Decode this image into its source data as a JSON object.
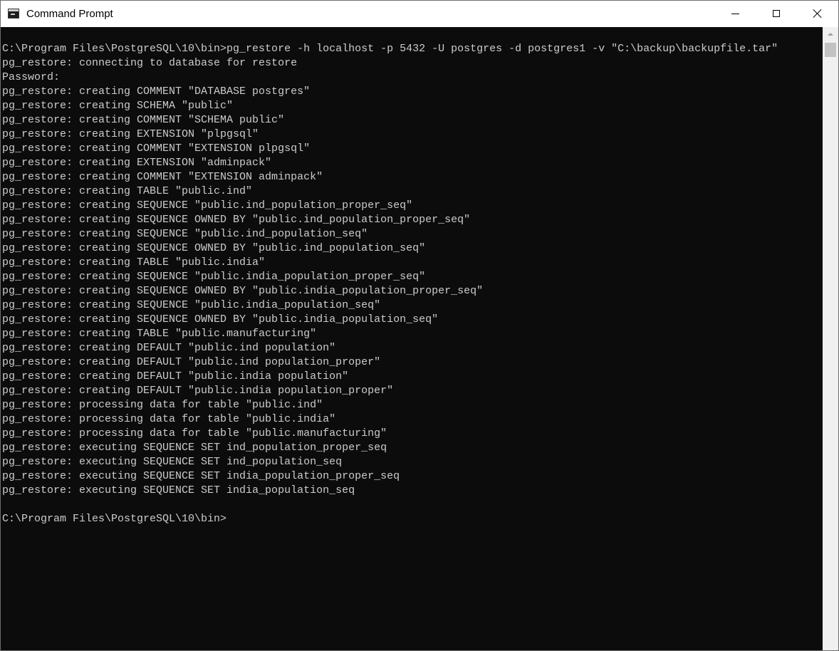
{
  "window": {
    "title": "Command Prompt"
  },
  "console": {
    "lines": [
      "C:\\Program Files\\PostgreSQL\\10\\bin>pg_restore -h localhost -p 5432 -U postgres -d postgres1 -v \"C:\\backup\\backupfile.tar\"",
      "pg_restore: connecting to database for restore",
      "Password:",
      "pg_restore: creating COMMENT \"DATABASE postgres\"",
      "pg_restore: creating SCHEMA \"public\"",
      "pg_restore: creating COMMENT \"SCHEMA public\"",
      "pg_restore: creating EXTENSION \"plpgsql\"",
      "pg_restore: creating COMMENT \"EXTENSION plpgsql\"",
      "pg_restore: creating EXTENSION \"adminpack\"",
      "pg_restore: creating COMMENT \"EXTENSION adminpack\"",
      "pg_restore: creating TABLE \"public.ind\"",
      "pg_restore: creating SEQUENCE \"public.ind_population_proper_seq\"",
      "pg_restore: creating SEQUENCE OWNED BY \"public.ind_population_proper_seq\"",
      "pg_restore: creating SEQUENCE \"public.ind_population_seq\"",
      "pg_restore: creating SEQUENCE OWNED BY \"public.ind_population_seq\"",
      "pg_restore: creating TABLE \"public.india\"",
      "pg_restore: creating SEQUENCE \"public.india_population_proper_seq\"",
      "pg_restore: creating SEQUENCE OWNED BY \"public.india_population_proper_seq\"",
      "pg_restore: creating SEQUENCE \"public.india_population_seq\"",
      "pg_restore: creating SEQUENCE OWNED BY \"public.india_population_seq\"",
      "pg_restore: creating TABLE \"public.manufacturing\"",
      "pg_restore: creating DEFAULT \"public.ind population\"",
      "pg_restore: creating DEFAULT \"public.ind population_proper\"",
      "pg_restore: creating DEFAULT \"public.india population\"",
      "pg_restore: creating DEFAULT \"public.india population_proper\"",
      "pg_restore: processing data for table \"public.ind\"",
      "pg_restore: processing data for table \"public.india\"",
      "pg_restore: processing data for table \"public.manufacturing\"",
      "pg_restore: executing SEQUENCE SET ind_population_proper_seq",
      "pg_restore: executing SEQUENCE SET ind_population_seq",
      "pg_restore: executing SEQUENCE SET india_population_proper_seq",
      "pg_restore: executing SEQUENCE SET india_population_seq",
      "",
      "C:\\Program Files\\PostgreSQL\\10\\bin>"
    ]
  },
  "colors": {
    "console_background": "#0c0c0c",
    "console_text": "#cccccc",
    "titlebar_background": "#ffffff"
  },
  "icons": {
    "app": "command-prompt-icon",
    "minimize": "minimize-icon",
    "maximize": "maximize-icon",
    "close": "close-icon"
  }
}
